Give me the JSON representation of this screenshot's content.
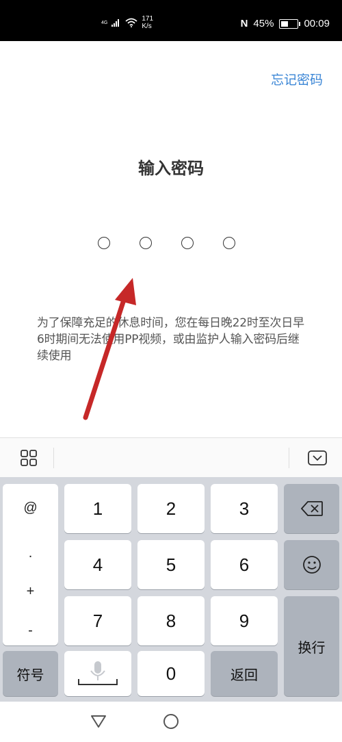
{
  "status_bar": {
    "network": "4G",
    "speed_value": "171",
    "speed_unit": "K/s",
    "nfc": "N",
    "battery_percent": "45%",
    "battery_level": 0.45,
    "time": "00:09"
  },
  "header": {
    "forgot_password": "忘记密码"
  },
  "main": {
    "title": "输入密码",
    "pin_length": 4,
    "notice": "为了保障充足的休息时间，您在每日晚22时至次日早6时期间无法使用PP视频，或由监护人输入密码后继续使用"
  },
  "keyboard": {
    "symbols": [
      "@",
      ".",
      "+",
      "-"
    ],
    "keys_row1": [
      "1",
      "2",
      "3"
    ],
    "keys_row2": [
      "4",
      "5",
      "6"
    ],
    "keys_row3": [
      "7",
      "8",
      "9"
    ],
    "symbol_key": "符号",
    "zero_key": "0",
    "return_key": "返回",
    "enter_key": "换行"
  },
  "icons": {
    "toolbar_left": "grid-icon",
    "toolbar_right": "keyboard-hide-icon",
    "delete": "backspace-icon",
    "emoji": "emoji-icon",
    "voice": "microphone-icon",
    "arrow": "annotation-arrow",
    "arrow_color": "#c62828"
  }
}
